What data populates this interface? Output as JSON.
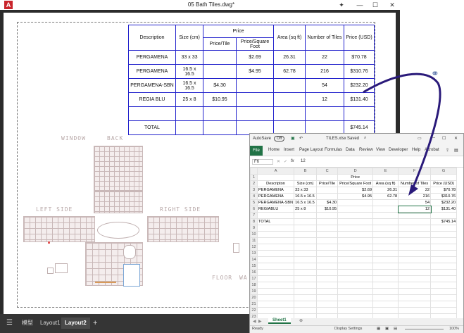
{
  "acad": {
    "title": "05 Bath Tiles.dwg*",
    "logo_letter": "A",
    "tabs": [
      "模型",
      "Layout1",
      "Layout2",
      "+"
    ],
    "menu_icon": "hamburger-icon",
    "win_buttons": {
      "minimize": "—",
      "restore": "☐",
      "close": "✕",
      "pin": "✦"
    }
  },
  "cad_table": {
    "headers": {
      "description": "Description",
      "size": "Size (cm)",
      "price": "Price",
      "price_tile": "Price/Tile",
      "price_sqft": "Price/Square Foot",
      "area": "Area (sq ft)",
      "num_tiles": "Number of Tiles",
      "price_usd": "Price (USD)"
    },
    "rows": [
      {
        "desc": "PERGAMENA",
        "size": "33 x 33",
        "tile": "",
        "sqft": "$2.69",
        "area": "26.31",
        "num": "22",
        "usd": "$70.78"
      },
      {
        "desc": "PERGAMENA",
        "size": "16.5 x 16.5",
        "tile": "",
        "sqft": "$4.95",
        "area": "62.78",
        "num": "216",
        "usd": "$310.76"
      },
      {
        "desc": "PERGAMENA-SBN",
        "size": "16.5 x 16.5",
        "tile": "$4.30",
        "sqft": "",
        "area": "",
        "num": "54",
        "usd": "$232.20"
      },
      {
        "desc": "REGIA BLU",
        "size": "25 x 8",
        "tile": "$10.95",
        "sqft": "",
        "area": "",
        "num": "12",
        "usd": "$131.40"
      }
    ],
    "total_label": "TOTAL",
    "total_value": "$745.14"
  },
  "drawing_labels": {
    "window": "WINDOW",
    "back": "BACK",
    "left_side": "LEFT SIDE",
    "right_side": "RIGHT SIDE",
    "floor": "FLOOR",
    "wa": "WA"
  },
  "excel": {
    "autosave": "AutoSave",
    "autosave_state": "Off",
    "file_name": "TILES.xlsx",
    "save_state": "Saved",
    "ribbon_tabs": [
      "File",
      "Home",
      "Insert",
      "Page Layout",
      "Formulas",
      "Data",
      "Review",
      "View",
      "Developer",
      "Help",
      "Acrobat"
    ],
    "name_box": "F6",
    "formula_value": "12",
    "fx": "fx",
    "col_headers": [
      "",
      "A",
      "B",
      "C",
      "D",
      "E",
      "F",
      "G"
    ],
    "grid": [
      {
        "n": "1",
        "c": [
          "",
          "",
          "",
          "Price",
          "",
          "",
          ""
        ]
      },
      {
        "n": "2",
        "c": [
          "Descripton",
          "Size (cm)",
          "Price/Tile",
          "Price/Square Foot",
          "Area (sq ft)",
          "Number of Tiles",
          "Price (USD)"
        ]
      },
      {
        "n": "3",
        "c": [
          "PERGAMENA",
          "33 x 33",
          "",
          "$2.69",
          "26.31",
          "22",
          "$70.78"
        ]
      },
      {
        "n": "4",
        "c": [
          "PERGAMENA",
          "16.5 x 16.5",
          "",
          "$4.95",
          "62.78",
          "216",
          "$310.76"
        ]
      },
      {
        "n": "5",
        "c": [
          "PERGAMENA-SBN",
          "16.5 x 16.5",
          "$4.30",
          "",
          "",
          "54",
          "$232.20"
        ]
      },
      {
        "n": "6",
        "c": [
          "REGIABLU",
          "25 x 8",
          "$10.95",
          "",
          "",
          "12",
          "$131.40"
        ]
      },
      {
        "n": "7",
        "c": [
          "",
          "",
          "",
          "",
          "",
          "",
          ""
        ]
      },
      {
        "n": "8",
        "c": [
          "TOTAL",
          "",
          "",
          "",
          "",
          "",
          "$745.14"
        ]
      },
      {
        "n": "9",
        "c": [
          "",
          "",
          "",
          "",
          "",
          "",
          ""
        ]
      },
      {
        "n": "10",
        "c": [
          "",
          "",
          "",
          "",
          "",
          "",
          ""
        ]
      },
      {
        "n": "11",
        "c": [
          "",
          "",
          "",
          "",
          "",
          "",
          ""
        ]
      },
      {
        "n": "12",
        "c": [
          "",
          "",
          "",
          "",
          "",
          "",
          ""
        ]
      },
      {
        "n": "13",
        "c": [
          "",
          "",
          "",
          "",
          "",
          "",
          ""
        ]
      },
      {
        "n": "14",
        "c": [
          "",
          "",
          "",
          "",
          "",
          "",
          ""
        ]
      },
      {
        "n": "15",
        "c": [
          "",
          "",
          "",
          "",
          "",
          "",
          ""
        ]
      },
      {
        "n": "16",
        "c": [
          "",
          "",
          "",
          "",
          "",
          "",
          ""
        ]
      },
      {
        "n": "17",
        "c": [
          "",
          "",
          "",
          "",
          "",
          "",
          ""
        ]
      },
      {
        "n": "18",
        "c": [
          "",
          "",
          "",
          "",
          "",
          "",
          ""
        ]
      },
      {
        "n": "19",
        "c": [
          "",
          "",
          "",
          "",
          "",
          "",
          ""
        ]
      },
      {
        "n": "20",
        "c": [
          "",
          "",
          "",
          "",
          "",
          "",
          ""
        ]
      },
      {
        "n": "21",
        "c": [
          "",
          "",
          "",
          "",
          "",
          "",
          ""
        ]
      },
      {
        "n": "22",
        "c": [
          "",
          "",
          "",
          "",
          "",
          "",
          ""
        ]
      },
      {
        "n": "23",
        "c": [
          "",
          "",
          "",
          "",
          "",
          "",
          ""
        ]
      },
      {
        "n": "24",
        "c": [
          "",
          "",
          "",
          "",
          "",
          "",
          ""
        ]
      },
      {
        "n": "25",
        "c": [
          "",
          "",
          "",
          "",
          "",
          "",
          ""
        ]
      }
    ],
    "sheet_tab": "Sheet1",
    "status_ready": "Ready",
    "display_settings": "Display Settings",
    "zoom": "100%"
  },
  "colors": {
    "cad_table_border": "#2222cc",
    "arrow": "#2a1a7a",
    "excel_green": "#217346"
  }
}
